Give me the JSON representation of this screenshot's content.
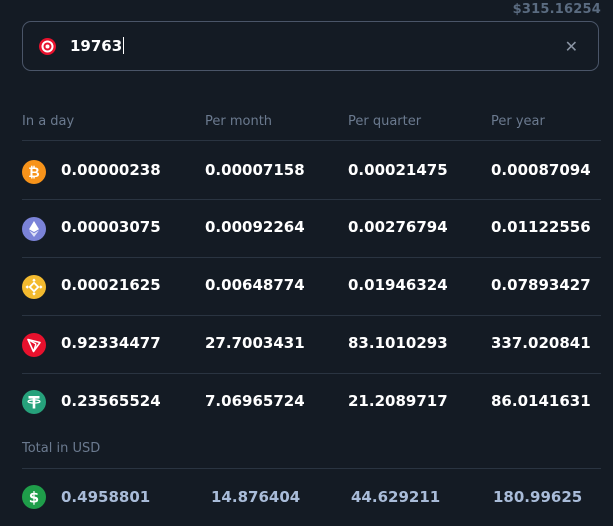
{
  "balance": "$315.16254",
  "search": {
    "value": "19763"
  },
  "columns": [
    "In a day",
    "Per month",
    "Per quarter",
    "Per year"
  ],
  "rows": [
    {
      "icon": "bitcoin-icon",
      "color": "#f7931a",
      "values": [
        "0.00000238",
        "0.00007158",
        "0.00021475",
        "0.00087094"
      ]
    },
    {
      "icon": "ethereum-icon",
      "color": "#7b83d8",
      "values": [
        "0.00003075",
        "0.00092264",
        "0.00276794",
        "0.01122556"
      ]
    },
    {
      "icon": "bnb-icon",
      "color": "#f3ba2f",
      "values": [
        "0.00021625",
        "0.00648774",
        "0.01946324",
        "0.07893427"
      ]
    },
    {
      "icon": "tron-icon",
      "color": "#e8112d",
      "values": [
        "0.92334477",
        "27.7003431",
        "83.1010293",
        "337.020841"
      ]
    },
    {
      "icon": "tether-icon",
      "color": "#26a17b",
      "values": [
        "0.23565524",
        "7.06965724",
        "21.2089717",
        "86.0141631"
      ]
    }
  ],
  "total": {
    "label": "Total in USD",
    "icon": "dollar-icon",
    "color": "#1f9e4a",
    "values": [
      "0.4958801",
      "14.876404",
      "44.629211",
      "180.99625"
    ]
  }
}
